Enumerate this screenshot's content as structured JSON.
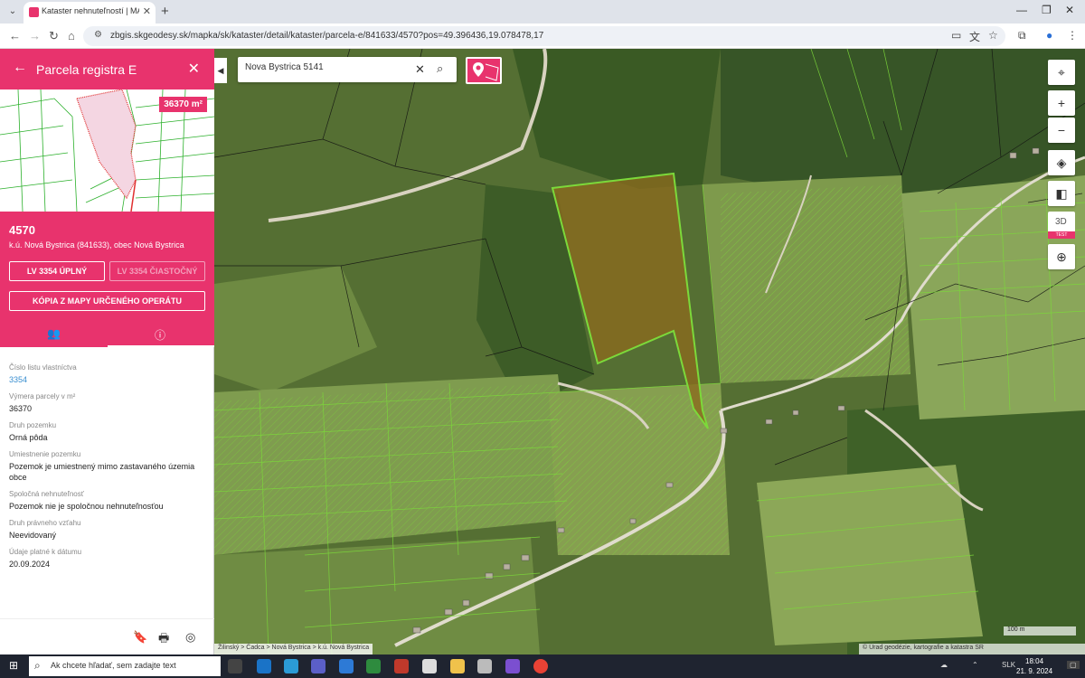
{
  "browser": {
    "tab_title": "Kataster nehnuteľností | MAPKA",
    "url": "zbgis.skgeodesy.sk/mapka/sk/kataster/detail/kataster/parcela-e/841633/4570?pos=49.396436,19.078478,17",
    "icons": [
      "tab-dropdown",
      "back",
      "forward",
      "reload",
      "home",
      "site-info",
      "cast",
      "translate",
      "star",
      "extensions",
      "profile",
      "menu"
    ]
  },
  "panel": {
    "title": "Parcela registra E",
    "area_badge": "36370 m²",
    "parcel_number": "4570",
    "cadastral_area": "k.ú. Nová Bystrica (841633), obec Nová Bystrica",
    "btn_full": "LV 3354 ÚPLNÝ",
    "btn_partial": "LV 3354 ČIASTOČNÝ",
    "btn_copy": "KÓPIA Z MAPY URČENÉHO OPERÁTU",
    "fields": [
      {
        "label": "Číslo listu vlastníctva",
        "value": "3354"
      },
      {
        "label": "Výmera parcely v m²",
        "value": "36370"
      },
      {
        "label": "Druh pozemku",
        "value": "Orná pôda"
      },
      {
        "label": "Umiestnenie pozemku",
        "value": "Pozemok je umiestnený mimo zastavaného územia obce"
      },
      {
        "label": "Spoločná nehnuteľnosť",
        "value": "Pozemok nie je spoločnou nehnuteľnosťou"
      },
      {
        "label": "Druh právneho vzťahu",
        "value": "Neevidovaný"
      },
      {
        "label": "Údaje platné k dátumu",
        "value": "20.09.2024"
      }
    ]
  },
  "map": {
    "search_value": "Nova Bystrica 5141",
    "d3_label": "3D",
    "d3_badge": "TEST",
    "scale": "100 m",
    "breadcrumb": "Žilinský > Čadca > Nová Bystrica > k.ú. Nová Bystrica",
    "attribution": "© Úrad geodézie, kartografie a katastra SR",
    "parcel_color": "#8a6a1e",
    "boundary_color": "#7cd93a"
  },
  "taskbar": {
    "search_placeholder": "Ak chcete hľadať, sem zadajte text",
    "lang": "SLK",
    "time": "18:04",
    "date": "21. 9. 2024"
  }
}
